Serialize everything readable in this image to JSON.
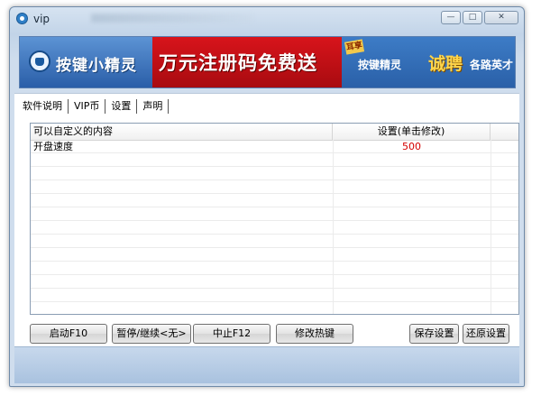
{
  "window": {
    "title": "vip"
  },
  "banner": {
    "brand": "按键小精灵",
    "promo": "万元注册码免费送",
    "seal": "耳享",
    "recruit_a": "按键精灵",
    "recruit_b": "诚聘",
    "recruit_c": "各路英才"
  },
  "tabs": [
    "软件说明",
    "VIP币",
    "设置",
    "声明"
  ],
  "active_tab": "VIP币",
  "table": {
    "columns": [
      "可以自定义的内容",
      "设置(单击修改)"
    ],
    "rows": [
      {
        "name": "开盘速度",
        "value": "500"
      }
    ],
    "value_color": "#d40000"
  },
  "buttons": {
    "start": "启动F10",
    "pause": "暂停/继续<无>",
    "stop": "中止F12",
    "hotkey": "修改热键",
    "save": "保存设置",
    "restore": "还原设置"
  }
}
